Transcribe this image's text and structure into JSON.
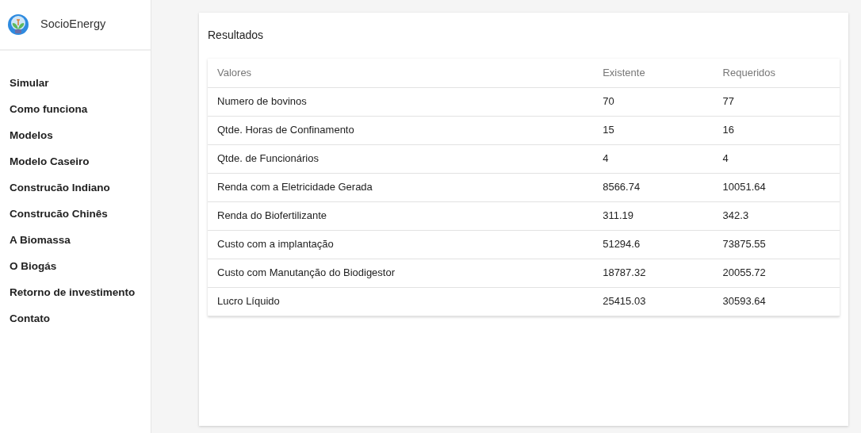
{
  "brand": {
    "name": "SocioEnergy"
  },
  "sidebar": {
    "items": [
      "Simular",
      "Como funciona",
      "Modelos",
      "Modelo Caseiro",
      "Construcão Indiano",
      "Construcão Chinês",
      "A Biomassa",
      "O Biogás",
      "Retorno de investimento",
      "Contato"
    ]
  },
  "card": {
    "title": "Resultados",
    "table": {
      "columns": [
        "Valores",
        "Existente",
        "Requeridos"
      ],
      "rows": [
        [
          "Numero de bovinos",
          "70",
          "77"
        ],
        [
          "Qtde. Horas de Confinamento",
          "15",
          "16"
        ],
        [
          "Qtde. de Funcionários",
          "4",
          "4"
        ],
        [
          "Renda com a Eletricidade Gerada",
          "8566.74",
          "10051.64"
        ],
        [
          "Renda do Biofertilizante",
          "311.19",
          "342.3"
        ],
        [
          "Custo com a implantação",
          "51294.6",
          "73875.55"
        ],
        [
          "Custo com Manutanção do Biodigestor",
          "18787.32",
          "20055.72"
        ],
        [
          "Lucro Líquido",
          "25415.03",
          "30593.64"
        ]
      ]
    }
  }
}
